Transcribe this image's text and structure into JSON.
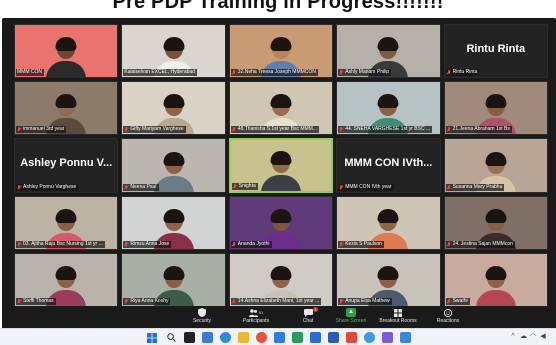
{
  "banner": {
    "title": "Pre PDP Training in Progress!!!!!!!"
  },
  "participants": [
    {
      "label": "MMM CON",
      "kind": "video",
      "bg": "#e9746d",
      "skin": "#6b4532",
      "shirt": "#2a2a2a",
      "muted": false
    },
    {
      "label": "Kalaiselvan EXCEL, Hyderabad",
      "kind": "video",
      "bg": "#d9d6cf",
      "skin": "#7a5236",
      "shirt": "#f0efe9",
      "muted": false
    },
    {
      "label": "32.Neha Treesa Joseph  MMMCON",
      "kind": "video",
      "bg": "#c99b73",
      "skin": "#b8835e",
      "shirt": "#5f7fb0",
      "muted": true
    },
    {
      "label": "Ashly Mariam Philip",
      "kind": "video",
      "bg": "#b5b0aa",
      "skin": "#7d5a44",
      "shirt": "#3a3a3a",
      "muted": true
    },
    {
      "label": "Rintu Rinta",
      "kind": "name",
      "display": "Rintu Rinta",
      "muted": true
    },
    {
      "label": "immanuel 3rd year",
      "kind": "video",
      "bg": "#8c7a6b",
      "skin": "#8d6a52",
      "shirt": "#5b4a3d",
      "muted": true
    },
    {
      "label": "Gifty Mariyam Varghese",
      "kind": "video",
      "bg": "#d8d3c4",
      "skin": "#8e6148",
      "shirt": "#b8a88e",
      "muted": true
    },
    {
      "label": "48.Thanisha S.1st year Bsc MMM...",
      "kind": "video",
      "bg": "#cfc7b4",
      "skin": "#9b6b50",
      "shirt": "#e9e0c9",
      "muted": true
    },
    {
      "label": "44. SNEHA VARGHESE 1st yr BSC ...",
      "kind": "video",
      "bg": "#b7c2c4",
      "skin": "#8a6046",
      "shirt": "#3e8f72",
      "muted": true
    },
    {
      "label": "21.Jeena Abraham 1st Bs",
      "kind": "video",
      "bg": "#a08a7c",
      "skin": "#8a5d43",
      "shirt": "#b0506a",
      "muted": true
    },
    {
      "label": "Ashley Ponnu Varghese",
      "kind": "name",
      "display": "Ashley Ponnu V...",
      "muted": true
    },
    {
      "label": "Neena Paul",
      "kind": "video",
      "bg": "#b9b7b0",
      "skin": "#8a6147",
      "shirt": "#6c7b87",
      "muted": true
    },
    {
      "label": "Snighta",
      "kind": "video",
      "bg": "#c8c28e",
      "skin": "#8c6a4a",
      "shirt": "#3b3f45",
      "muted": true,
      "active": true
    },
    {
      "label": "MMM CON IVth year",
      "kind": "name",
      "display": "MMM CON IVth...",
      "muted": true
    },
    {
      "label": "Susanna Mary Prabhu",
      "kind": "video",
      "bg": "#b9a595",
      "skin": "#9c6f52",
      "shirt": "#d7c3a6",
      "muted": true
    },
    {
      "label": "03. Ajitha Raju Bsc Nursing 1st yr ...",
      "kind": "video",
      "bg": "#bdb3a5",
      "skin": "#8a5f44",
      "shirt": "#cf5b6b",
      "muted": true
    },
    {
      "label": "Rimsu Anna Jose",
      "kind": "video",
      "bg": "#d1d4d2",
      "skin": "#8c6248",
      "shirt": "#8c2f4a",
      "muted": true
    },
    {
      "label": "Ananda Jyothi",
      "kind": "video",
      "bg": "#5f3b7b",
      "skin": "#7d5640",
      "shirt": "#6b2e8f",
      "muted": true
    },
    {
      "label": "Kezia S Paulson",
      "kind": "video",
      "bg": "#cfc5b6",
      "skin": "#8f6449",
      "shirt": "#dd7a52",
      "muted": true
    },
    {
      "label": "24. Jestina Sajan MMMcon",
      "kind": "video",
      "bg": "#7f6f66",
      "skin": "#87604a",
      "shirt": "#3b2b2b",
      "muted": true
    },
    {
      "label": "Steffi Thomas",
      "kind": "video",
      "bg": "#b9b3ab",
      "skin": "#8d6148",
      "shirt": "#9d3d5e",
      "muted": true
    },
    {
      "label": "Riya Anna Koshy",
      "kind": "video",
      "bg": "#a8b0a5",
      "skin": "#8a5f46",
      "shirt": "#3c5b49",
      "muted": true
    },
    {
      "label": "14.Ashna Elizabeth Mani, 1st year ...",
      "kind": "video",
      "bg": "#d0cbc4",
      "skin": "#8a634b",
      "shirt": "#c9c2b9",
      "muted": true
    },
    {
      "label": "Anupa Elsa Mathew",
      "kind": "video",
      "bg": "#c7c3bb",
      "skin": "#8b6149",
      "shirt": "#4b5a6e",
      "muted": true
    },
    {
      "label": "Swathi",
      "kind": "video",
      "bg": "#c9aa9e",
      "skin": "#8f6247",
      "shirt": "#b44752",
      "muted": true
    }
  ],
  "toolbar": {
    "security": "Security",
    "participants": "Participants",
    "participants_count": "51",
    "chat": "Chat",
    "chat_badge": "1",
    "share_screen": "Share Screen",
    "breakout_rooms": "Breakout Rooms",
    "reactions": "Reactions"
  },
  "icons": {
    "security": "shield-icon",
    "participants": "people-icon",
    "chat": "chat-icon",
    "share_screen": "share-screen-icon",
    "breakout_rooms": "breakout-rooms-icon",
    "reactions": "reactions-icon"
  },
  "colors": {
    "meeting_bg": "#1a1a1a",
    "active_speaker": "#8fd14f",
    "share_green": "#2ea043",
    "muted_red": "#e64545"
  }
}
